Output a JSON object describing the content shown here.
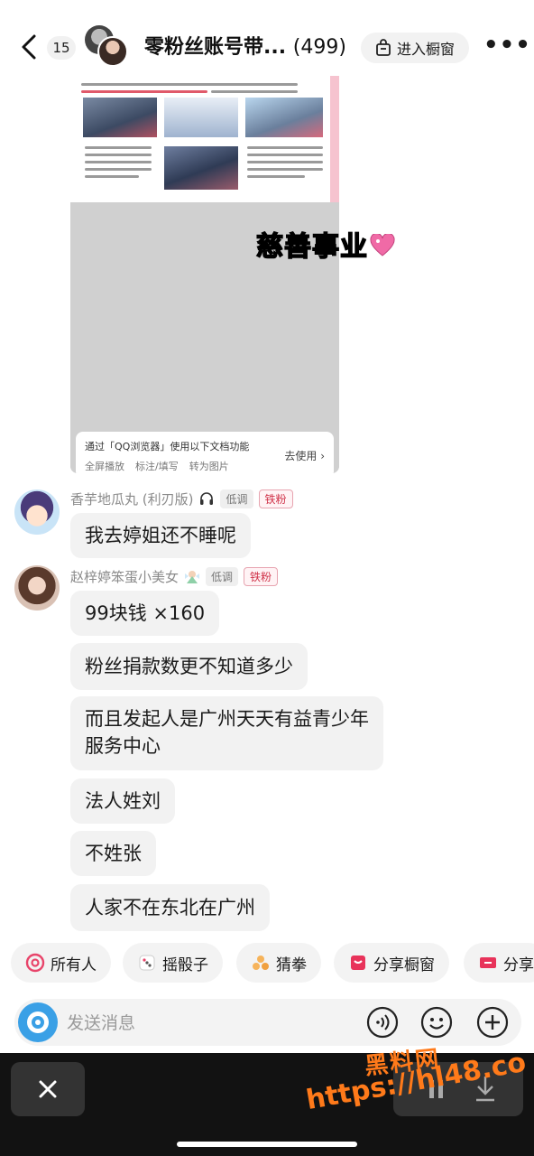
{
  "header": {
    "unread_count": "15",
    "title": "零粉丝账号带...",
    "member_count": "(499)",
    "shop_button": "进入橱窗"
  },
  "shared_image": {
    "sticker_text": "慈善事业",
    "qq_card": {
      "title": "通过「QQ浏览器」使用以下文档功能",
      "actions": [
        "全屏播放",
        "标注/填写",
        "转为图片"
      ],
      "use_label": "去使用 ›"
    }
  },
  "messages": [
    {
      "sender": "香芋地瓜丸 (利刃版)",
      "level": "低调",
      "fan_badge": "铁粉",
      "text": "我去婷姐还不睡呢"
    },
    {
      "sender": "赵梓婷笨蛋小美女",
      "level": "低调",
      "fan_badge": "铁粉",
      "text": "99块钱 ×160"
    },
    {
      "text": "粉丝捐款数更不知道多少"
    },
    {
      "text_line1": "而且发起人是广州天天有益青少年",
      "text_line2": "服务中心"
    },
    {
      "text": "法人姓刘"
    },
    {
      "text": "不姓张"
    },
    {
      "text": "人家不在东北在广州"
    }
  ],
  "quick_actions": [
    "所有人",
    "摇骰子",
    "猜拳",
    "分享橱窗",
    "分享"
  ],
  "input": {
    "placeholder": "发送消息"
  },
  "watermark": {
    "line1": "黑料网",
    "line2": "https://hl48.co"
  },
  "colors": {
    "fan_badge": "#d0334a",
    "bubble_bg": "#f2f2f2",
    "bottom_bar": "#121212",
    "watermark": "#ff7a1a"
  }
}
